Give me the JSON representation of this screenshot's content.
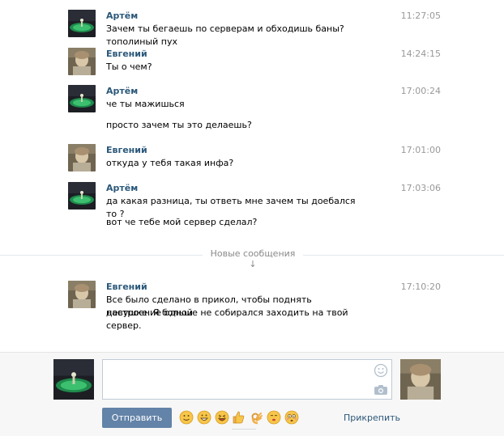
{
  "messages": [
    {
      "author": "Артём",
      "time": "11:27:05",
      "lines": [
        "Зачем ты бегаешь по серверам и обходишь баны?тополиный пух"
      ]
    },
    {
      "author": "Евгений",
      "time": "14:24:15",
      "lines": [
        "Ты о чем?"
      ]
    },
    {
      "author": "Артём",
      "time": "17:00:24",
      "lines": [
        "че ты мажишься",
        "просто зачем ты это делаешь?"
      ]
    },
    {
      "author": "Евгений",
      "time": "17:01:00",
      "lines": [
        "откуда у тебя такая инфа?"
      ]
    },
    {
      "author": "Артём",
      "time": "17:03:06",
      "lines": [
        "да какая разница, ты ответь мне зачем ты доебался то ?",
        "вот че тебе мой сервер сделал?"
      ]
    },
    {
      "author": "Евгений",
      "time": "17:10:20",
      "lines": [
        "Все было сделано в прикол, чтобы поднять настроение одной",
        "девушке. Я больше не собирался заходить на твой сервер."
      ]
    }
  ],
  "divider": {
    "label": "Новые сообщения ↓"
  },
  "composer": {
    "placeholder": "",
    "send_label": "Отправить",
    "attach_label": "Прикрепить"
  },
  "icons": {
    "emoji_picker": "smiley-icon",
    "camera": "camera-icon",
    "emojis": [
      "smile-emoji",
      "grin-emoji",
      "laugh-emoji",
      "thumbs-up-emoji",
      "ok-hand-emoji",
      "smirk-emoji",
      "blush-emoji"
    ]
  },
  "colors": {
    "author": "#2b587a",
    "send_button": "#6383a8",
    "time": "#999999"
  }
}
